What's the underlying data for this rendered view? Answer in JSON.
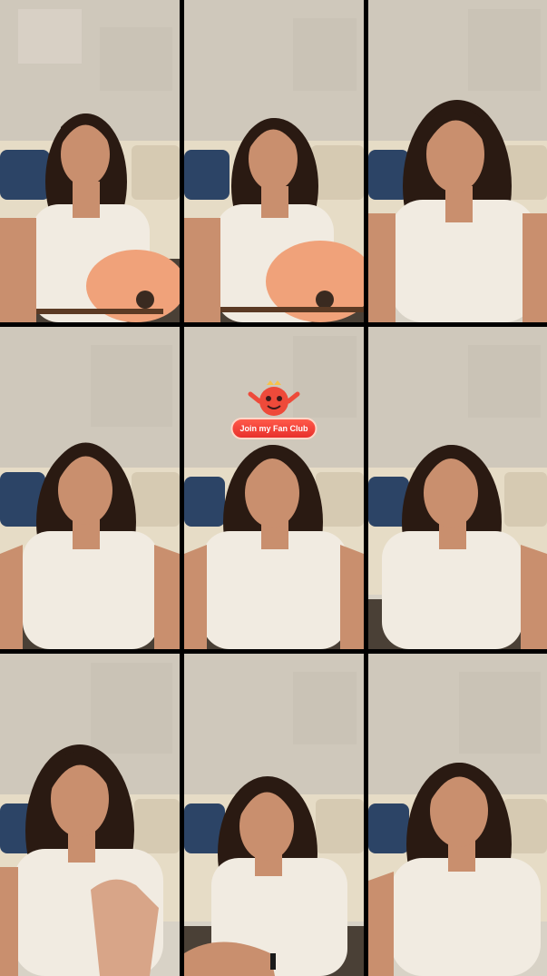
{
  "screen": {
    "layout": "3x3 grid of live video frames"
  },
  "frames": [
    {
      "id": 1,
      "has_guitar": true
    },
    {
      "id": 2,
      "has_guitar": true
    },
    {
      "id": 3,
      "has_guitar": false
    },
    {
      "id": 4,
      "has_guitar": false
    },
    {
      "id": 5,
      "has_guitar": false,
      "sticker": true
    },
    {
      "id": 6,
      "has_guitar": false
    },
    {
      "id": 7,
      "has_guitar": false
    },
    {
      "id": 8,
      "has_guitar": false
    },
    {
      "id": 9,
      "has_guitar": false
    }
  ],
  "sticker": {
    "label": "Join my Fan Club",
    "icon": "fan-club-mascot-icon"
  },
  "colors": {
    "wall": "#d8d2c6",
    "sofa": "#e6dcc6",
    "pillow_blue": "#2c4466",
    "hair": "#2a1a12",
    "skin": "#c98f6e",
    "top": "#f1ebe1",
    "guitar": "#f0a27a",
    "sticker_red": "#e8302c"
  }
}
